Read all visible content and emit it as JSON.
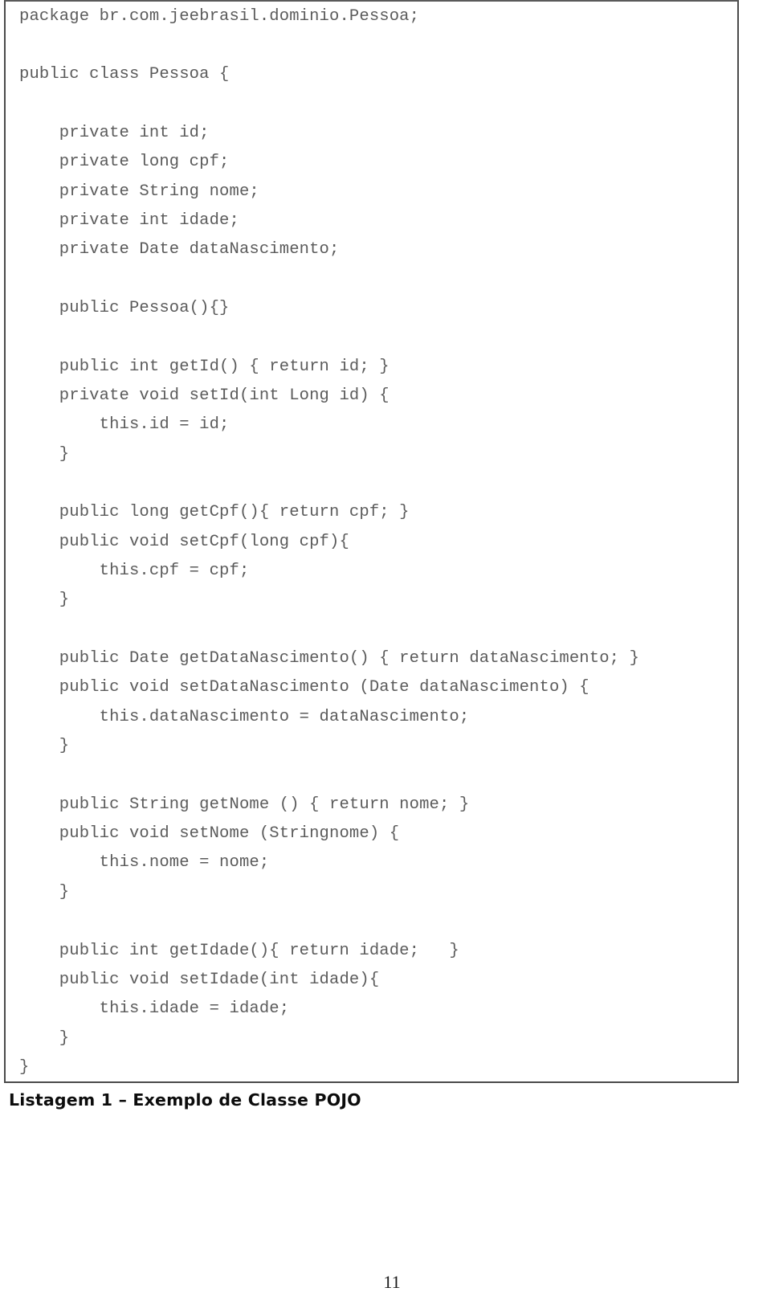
{
  "page": {
    "number": "11",
    "background_color": "#ffffff",
    "text_color": "#5b5b5b",
    "border_color": "#4a4a4a"
  },
  "code_listing": {
    "language": "java",
    "lines": [
      "package br.com.jeebrasil.dominio.Pessoa;",
      "",
      "public class Pessoa {",
      "",
      "    private int id;",
      "    private long cpf;",
      "    private String nome;",
      "    private int idade;",
      "    private Date dataNascimento;",
      "",
      "    public Pessoa(){}",
      "",
      "    public int getId() { return id; }",
      "    private void setId(int Long id) {",
      "        this.id = id;",
      "    }",
      "",
      "    public long getCpf(){ return cpf; }",
      "    public void setCpf(long cpf){",
      "        this.cpf = cpf;",
      "    }",
      "",
      "    public Date getDataNascimento() { return dataNascimento; }",
      "    public void setDataNascimento (Date dataNascimento) {",
      "        this.dataNascimento = dataNascimento;",
      "    }",
      "",
      "    public String getNome () { return nome; }",
      "    public void setNome (Stringnome) {",
      "        this.nome = nome;",
      "    }",
      "",
      "    public int getIdade(){ return idade;   }",
      "    public void setIdade(int idade){",
      "        this.idade = idade;",
      "    }",
      "}"
    ]
  },
  "caption": {
    "text": "Listagem 1 – Exemplo de Classe POJO"
  }
}
